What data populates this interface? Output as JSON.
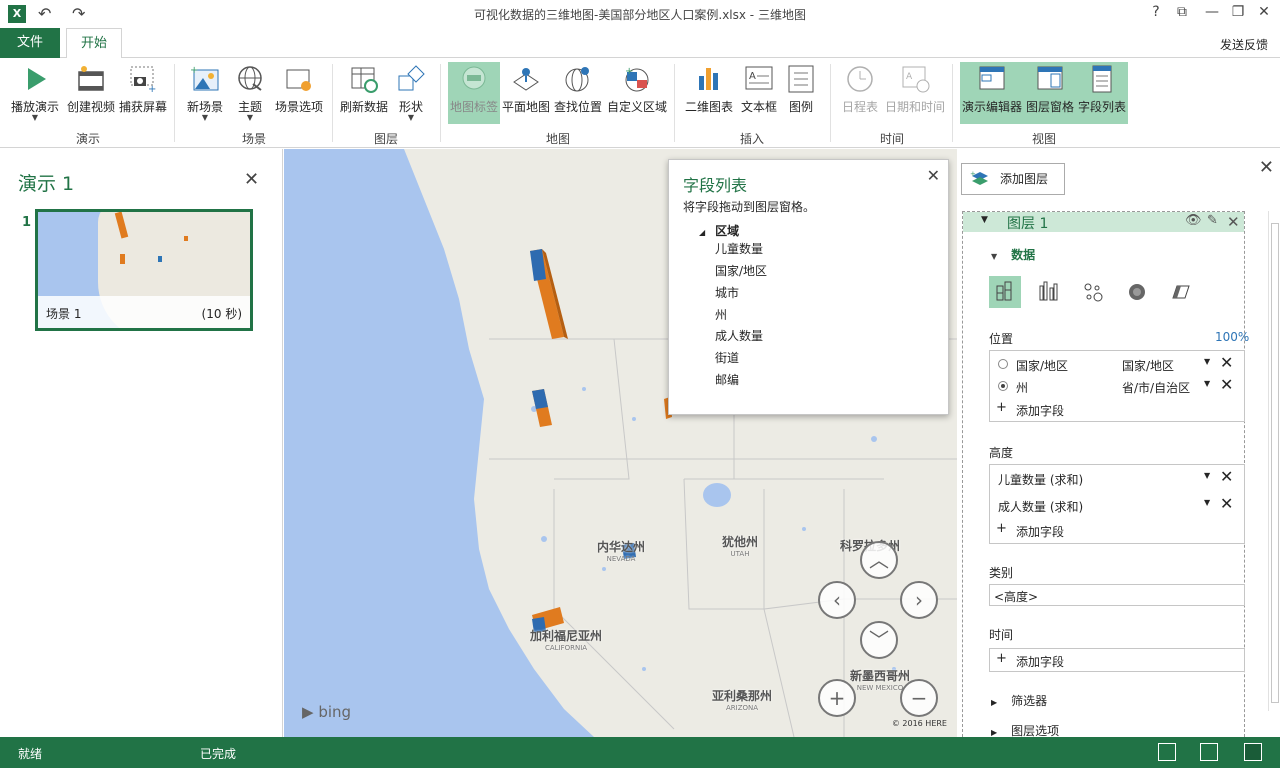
{
  "window": {
    "title": "可视化数据的三维地图-美国部分地区人口案例.xlsx - 三维地图",
    "help": "?",
    "restore": "⧉",
    "minimize": "—",
    "maximize": "❐",
    "close": "✕"
  },
  "tabs": {
    "file": "文件",
    "home": "开始",
    "feedback": "发送反馈"
  },
  "ribbon": {
    "tour": {
      "play": "播放演示",
      "create_video": "创建视频",
      "capture": "捕获屏幕",
      "label": "演示"
    },
    "scene": {
      "new_scene": "新场景",
      "theme": "主题",
      "options": "场景选项",
      "label": "场景"
    },
    "layer": {
      "refresh": "刷新数据",
      "shapes": "形状",
      "label": "图层"
    },
    "map": {
      "map_labels": "地图标签",
      "flat_map": "平面地图",
      "find_location": "查找位置",
      "custom_regions": "自定义区域",
      "label": "地图"
    },
    "insert": {
      "chart_2d": "二维图表",
      "text_box": "文本框",
      "legend": "图例",
      "label": "插入"
    },
    "time": {
      "timeline": "日程表",
      "date_time": "日期和时间",
      "label": "时间"
    },
    "view": {
      "tour_editor": "演示编辑器",
      "layer_pane": "图层窗格",
      "field_list": "字段列表",
      "label": "视图"
    }
  },
  "left_pane": {
    "title": "演示 1",
    "close": "✕",
    "scene_number": "1",
    "scene_name": "场景 1",
    "scene_duration": "(10 秒)"
  },
  "map": {
    "labels": [
      {
        "name": "内华达州",
        "sub": "NEVADA"
      },
      {
        "name": "犹他州",
        "sub": "UTAH"
      },
      {
        "name": "科罗拉多州",
        "sub": ""
      },
      {
        "name": "加利福尼亚州",
        "sub": "CALIFORNIA"
      },
      {
        "name": "亚利桑那州",
        "sub": "ARIZONA"
      },
      {
        "name": "新墨西哥州",
        "sub": "NEW MEXICO"
      }
    ],
    "bing": "bing",
    "copyright": "© 2016 HERE"
  },
  "field_list": {
    "title": "字段列表",
    "desc": "将字段拖动到图层窗格。",
    "close": "✕",
    "group": "区域",
    "fields": [
      "儿童数量",
      "国家/地区",
      "城市",
      "州",
      "成人数量",
      "街道",
      "邮编"
    ]
  },
  "right_pane": {
    "add_layer": "添加图层",
    "close": "✕",
    "layer_name": "图层 1",
    "data_label": "数据",
    "location_label": "位置",
    "location_pct": "100%",
    "location_rows": [
      {
        "field": "国家/地区",
        "type": "国家/地区",
        "selected": false
      },
      {
        "field": "州",
        "type": "省/市/自治区",
        "selected": true
      }
    ],
    "add_field": "添加字段",
    "height_label": "高度",
    "height_rows": [
      "儿童数量 (求和)",
      "成人数量 (求和)"
    ],
    "category_label": "类别",
    "category_value": "<高度>",
    "time_label": "时间",
    "filters": "筛选器",
    "layer_options": "图层选项"
  },
  "status": {
    "ready": "就绪",
    "done": "已完成"
  }
}
